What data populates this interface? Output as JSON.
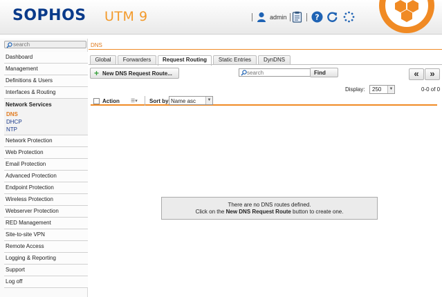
{
  "header": {
    "brand": "SOPHOS",
    "product": "UTM 9",
    "user": "admin",
    "icons": [
      "user-icon",
      "clipboard-icon",
      "help-icon",
      "reload-icon",
      "activity-spinner-icon",
      "hexagon-logo-icon"
    ],
    "colors": {
      "brand": "#0a3a8a",
      "accent": "#f08a24"
    }
  },
  "sidebar": {
    "search_placeholder": "search",
    "items_top": [
      "Dashboard",
      "Management",
      "Definitions & Users",
      "Interfaces & Routing"
    ],
    "group": {
      "title": "Network Services",
      "subitems": [
        {
          "label": "DNS",
          "active": true
        },
        {
          "label": "DHCP",
          "active": false
        },
        {
          "label": "NTP",
          "active": false
        }
      ]
    },
    "items_bottom": [
      "Network Protection",
      "Web Protection",
      "Email Protection",
      "Advanced Protection",
      "Endpoint Protection",
      "Wireless Protection",
      "Webserver Protection",
      "RED Management",
      "Site-to-site VPN",
      "Remote Access",
      "Logging & Reporting",
      "Support",
      "Log off"
    ]
  },
  "main": {
    "breadcrumb": "DNS",
    "tabs": [
      {
        "label": "Global",
        "active": false
      },
      {
        "label": "Forwarders",
        "active": false
      },
      {
        "label": "Request Routing",
        "active": true
      },
      {
        "label": "Static Entries",
        "active": false
      },
      {
        "label": "DynDNS",
        "active": false
      }
    ],
    "new_button": "New DNS Request Route...",
    "search_placeholder": "search",
    "find_button": "Find",
    "prev_page": "«",
    "next_page": "»",
    "display_label": "Display:",
    "display_value": "250",
    "count": "0-0 of 0",
    "list_header": {
      "action": "Action",
      "sort_label": "Sort by:",
      "sort_value": "Name asc"
    },
    "empty": {
      "line1": "There are no DNS routes defined.",
      "line2_prefix": "Click on the ",
      "line2_bold": "New DNS Request Route",
      "line2_suffix": " button to create one."
    }
  }
}
